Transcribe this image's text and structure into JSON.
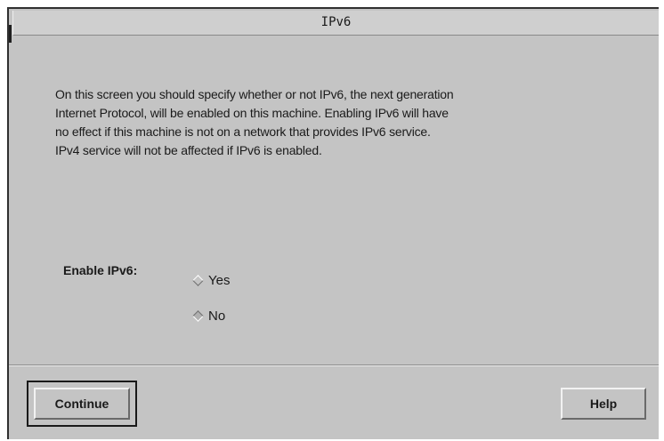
{
  "window": {
    "title": "IPv6"
  },
  "description": {
    "lines": [
      "On this screen you should specify whether or not IPv6, the next generation",
      "Internet Protocol, will be enabled on this machine.  Enabling IPv6 will have",
      "no effect if this machine is not on a network that provides IPv6 service.",
      "IPv4 service will not be affected if IPv6 is enabled."
    ]
  },
  "enable_ipv6": {
    "label": "Enable IPv6:",
    "options": [
      {
        "label": "Yes",
        "selected": false
      },
      {
        "label": "No",
        "selected": true
      }
    ]
  },
  "buttons": {
    "continue_label": "Continue",
    "help_label": "Help"
  }
}
